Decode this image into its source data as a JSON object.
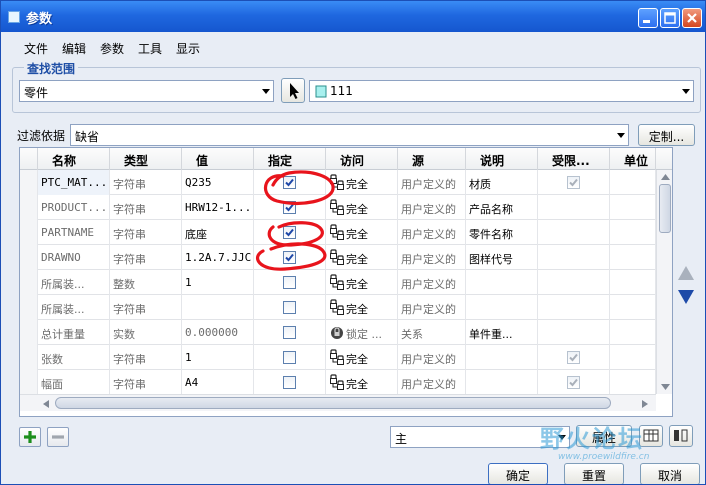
{
  "window": {
    "title": "参数"
  },
  "menu": [
    "文件",
    "编辑",
    "参数",
    "工具",
    "显示"
  ],
  "search_scope": {
    "label": "查找范围",
    "type_value": "零件",
    "object_value": "111"
  },
  "filter": {
    "label": "过滤依据",
    "value": "缺省",
    "customize_label": "定制..."
  },
  "table": {
    "columns": [
      "名称",
      "类型",
      "值",
      "指定",
      "访问",
      "源",
      "说明",
      "受限...",
      "单位"
    ],
    "rows": [
      {
        "name": "PTC_MAT...",
        "type": "字符串",
        "value": "Q235",
        "designated": true,
        "access": "完全",
        "source": "用户定义的",
        "desc": "材质",
        "restricted": true,
        "unit": ""
      },
      {
        "name": "PRODUCT...",
        "type": "字符串",
        "value": "HRW12-1...",
        "designated": true,
        "access": "完全",
        "source": "用户定义的",
        "desc": "产品名称",
        "restricted": false,
        "unit": ""
      },
      {
        "name": "PARTNAME",
        "type": "字符串",
        "value": "底座",
        "designated": true,
        "access": "完全",
        "source": "用户定义的",
        "desc": "零件名称",
        "restricted": false,
        "unit": ""
      },
      {
        "name": "DRAWNO",
        "type": "字符串",
        "value": "1.2A.7.JJC",
        "designated": true,
        "access": "完全",
        "source": "用户定义的",
        "desc": "图样代号",
        "restricted": false,
        "unit": ""
      },
      {
        "name": "所属装...",
        "type": "整数",
        "value": "1",
        "designated": false,
        "access": "完全",
        "source": "用户定义的",
        "desc": "",
        "restricted": false,
        "unit": ""
      },
      {
        "name": "所属装...",
        "type": "字符串",
        "value": "",
        "designated": false,
        "access": "完全",
        "source": "用户定义的",
        "desc": "",
        "restricted": false,
        "unit": ""
      },
      {
        "name": "总计重量",
        "type": "实数",
        "value": "0.000000",
        "designated": false,
        "access": "锁定 ...",
        "source": "关系",
        "desc": "单件重...",
        "restricted": false,
        "unit": ""
      },
      {
        "name": "张数",
        "type": "字符串",
        "value": "1",
        "designated": false,
        "access": "完全",
        "source": "用户定义的",
        "desc": "",
        "restricted": true,
        "unit": ""
      },
      {
        "name": "幅面",
        "type": "字符串",
        "value": "A4",
        "designated": false,
        "access": "完全",
        "source": "用户定义的",
        "desc": "",
        "restricted": true,
        "unit": ""
      }
    ]
  },
  "bottom": {
    "view_value": "主",
    "properties_label": "属性",
    "ok_label": "确定",
    "reset_label": "重置",
    "cancel_label": "取消",
    "watermark": "野火论坛",
    "watermark_url": "www.proewildfire.cn"
  },
  "colors": {
    "titlebar": "#1f68e0",
    "annotation": "#e8141c",
    "watermark": "#2f9bd6"
  }
}
